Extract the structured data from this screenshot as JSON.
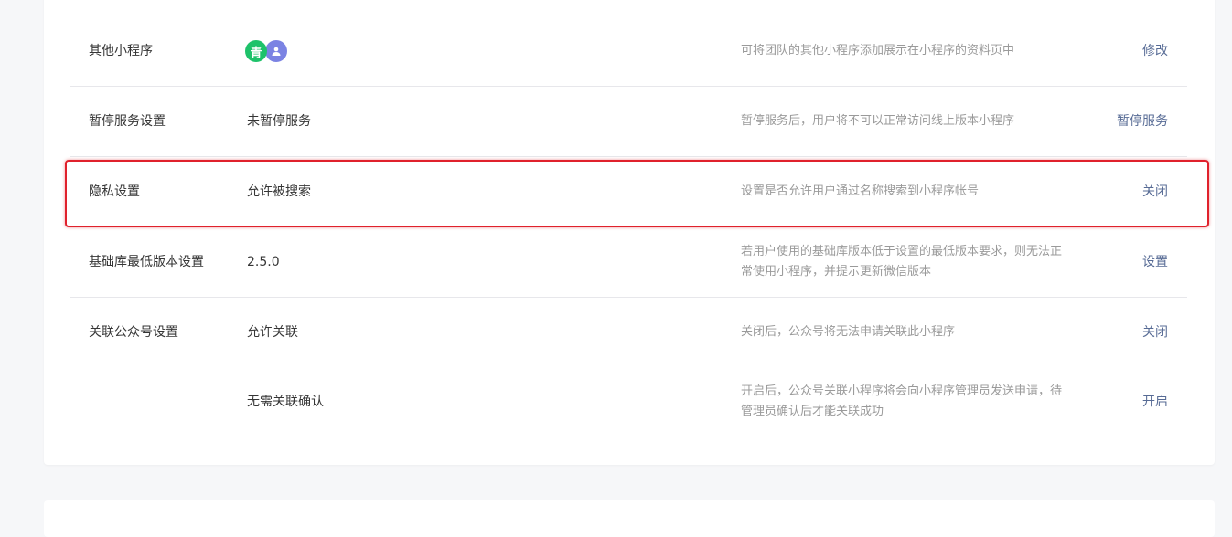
{
  "rows": [
    {
      "label": "其他小程序",
      "value": "",
      "desc": "可将团队的其他小程序添加展示在小程序的资料页中",
      "action": "修改"
    },
    {
      "label": "暂停服务设置",
      "value": "未暂停服务",
      "desc": "暂停服务后，用户将不可以正常访问线上版本小程序",
      "action": "暂停服务"
    },
    {
      "label": "隐私设置",
      "value": "允许被搜索",
      "desc": "设置是否允许用户通过名称搜索到小程序帐号",
      "action": "关闭"
    },
    {
      "label": "基础库最低版本设置",
      "value": "2.5.0",
      "desc": "若用户使用的基础库版本低于设置的最低版本要求，则无法正常使用小程序，并提示更新微信版本",
      "action": "设置"
    },
    {
      "label": "关联公众号设置",
      "value": "允许关联",
      "desc": "关闭后，公众号将无法申请关联此小程序",
      "action": "关闭"
    },
    {
      "label": "",
      "value": "无需关联确认",
      "desc": "开启后，公众号关联小程序将会向小程序管理员发送申请，待管理员确认后才能关联成功",
      "action": "开启"
    }
  ],
  "avatars": [
    {
      "glyph": "青",
      "color": "#1ec26a",
      "icon": "qing-logo-icon"
    },
    {
      "glyph": "",
      "color": "#7b83e3",
      "icon": "user-avatar-icon"
    }
  ],
  "highlight_color": "#e0212c"
}
